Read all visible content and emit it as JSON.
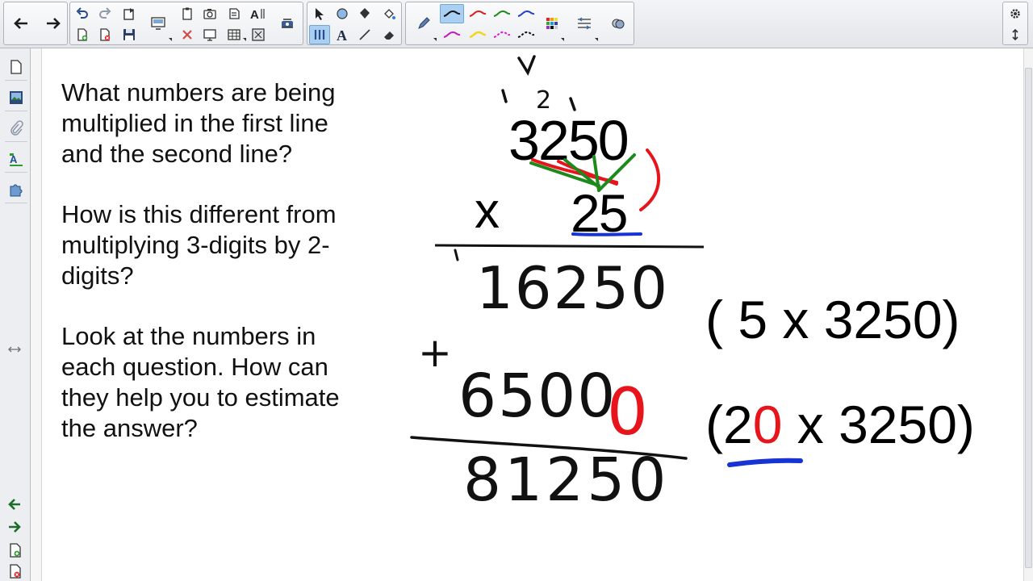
{
  "questions": [
    {
      "lines": [
        "What numbers are being",
        "multiplied in the first line",
        "and the second line?"
      ]
    },
    {
      "lines": [
        "How is this different from",
        "multiplying 3-digits by 2-",
        "digits?"
      ]
    },
    {
      "lines": [
        "Look at the numbers in",
        "each question. How can",
        "they help you to estimate",
        "the answer?"
      ]
    }
  ],
  "problem": {
    "multiplicand": "3250",
    "operator": "x",
    "multiplier": "25",
    "partial_1": "16250",
    "plus_sign": "+",
    "partial_2": "6500",
    "placeholder_zero": "0",
    "total": "81250",
    "carry_mark": "2"
  },
  "explanations": {
    "line1": "( 5 x 3250)",
    "line2_open": "(2",
    "line2_zero": "0",
    "line2_rest": " x 3250)"
  },
  "colors": {
    "red_ink": "#e8141b",
    "green_ink": "#1e8a1e",
    "blue_ink": "#1733d6",
    "black_ink": "#111111"
  },
  "toolbar": {
    "icons": [
      "back-arrow",
      "forward-arrow",
      "undo",
      "redo",
      "paste",
      "new-page",
      "delete-page",
      "save",
      "screen-shade",
      "clear",
      "capture",
      "table",
      "fullscreen",
      "document-camera",
      "select",
      "shape",
      "fill",
      "eraser-alt",
      "pen",
      "text",
      "line",
      "eraser",
      "magic-pen",
      "properties",
      "settings"
    ]
  }
}
